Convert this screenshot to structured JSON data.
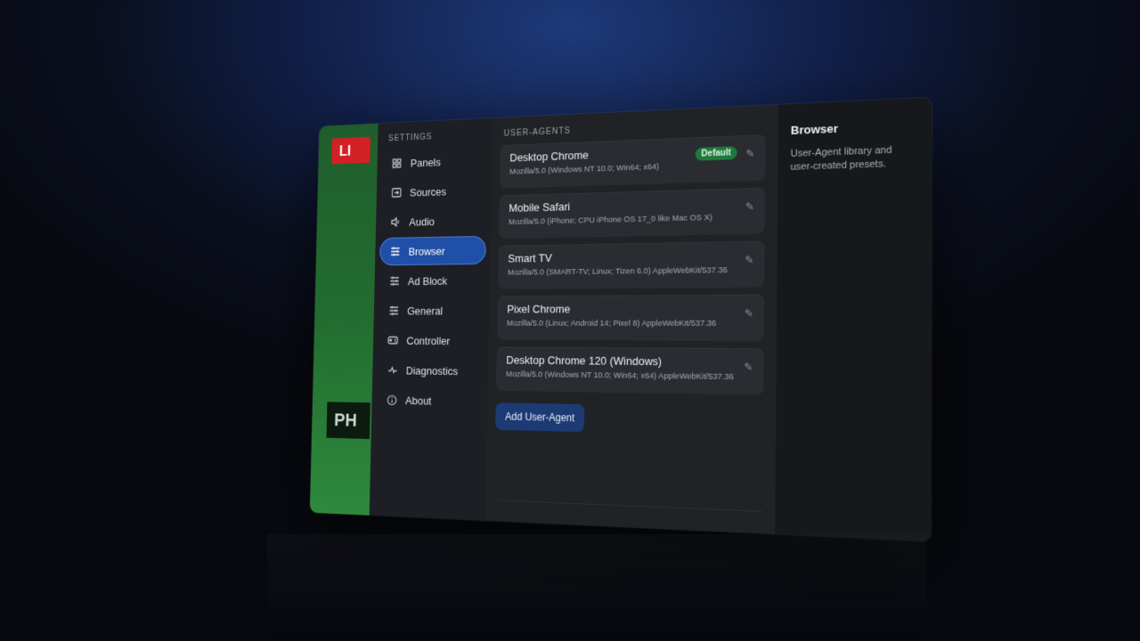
{
  "backdrop": {
    "live_label": "LI",
    "ph_label": "PH"
  },
  "sidebar": {
    "section_title": "SETTINGS",
    "items": [
      {
        "label": "Panels",
        "icon": "grid-icon"
      },
      {
        "label": "Sources",
        "icon": "input-icon"
      },
      {
        "label": "Audio",
        "icon": "speaker-icon"
      },
      {
        "label": "Browser",
        "icon": "sliders-icon",
        "active": true
      },
      {
        "label": "Ad Block",
        "icon": "sliders-icon"
      },
      {
        "label": "General",
        "icon": "sliders-icon"
      },
      {
        "label": "Controller",
        "icon": "gamepad-icon"
      },
      {
        "label": "Diagnostics",
        "icon": "pulse-icon"
      },
      {
        "label": "About",
        "icon": "info-icon"
      }
    ]
  },
  "main": {
    "section_title": "USER-AGENTS",
    "agents": [
      {
        "name": "Desktop Chrome",
        "ua": "Mozilla/5.0 (Windows NT 10.0; Win64; x64)",
        "badge": "Default"
      },
      {
        "name": "Mobile Safari",
        "ua": "Mozilla/5.0 (iPhone; CPU iPhone OS 17_0 like Mac OS X)"
      },
      {
        "name": "Smart TV",
        "ua": "Mozilla/5.0 (SMART-TV; Linux; Tizen 6.0) AppleWebKit/537.36"
      },
      {
        "name": "Pixel Chrome",
        "ua": "Mozilla/5.0 (Linux; Android 14; Pixel 8) AppleWebKit/537.36"
      },
      {
        "name": "Desktop Chrome 120 (Windows)",
        "ua": "Mozilla/5.0 (Windows NT 10.0; Win64; x64) AppleWebKit/537.36"
      }
    ],
    "add_button": "Add User-Agent"
  },
  "info": {
    "title": "Browser",
    "description": "User-Agent library and user-created presets."
  },
  "colors": {
    "accent": "#1f4fa6",
    "badge": "#1f7a3c",
    "live": "#d32024"
  }
}
